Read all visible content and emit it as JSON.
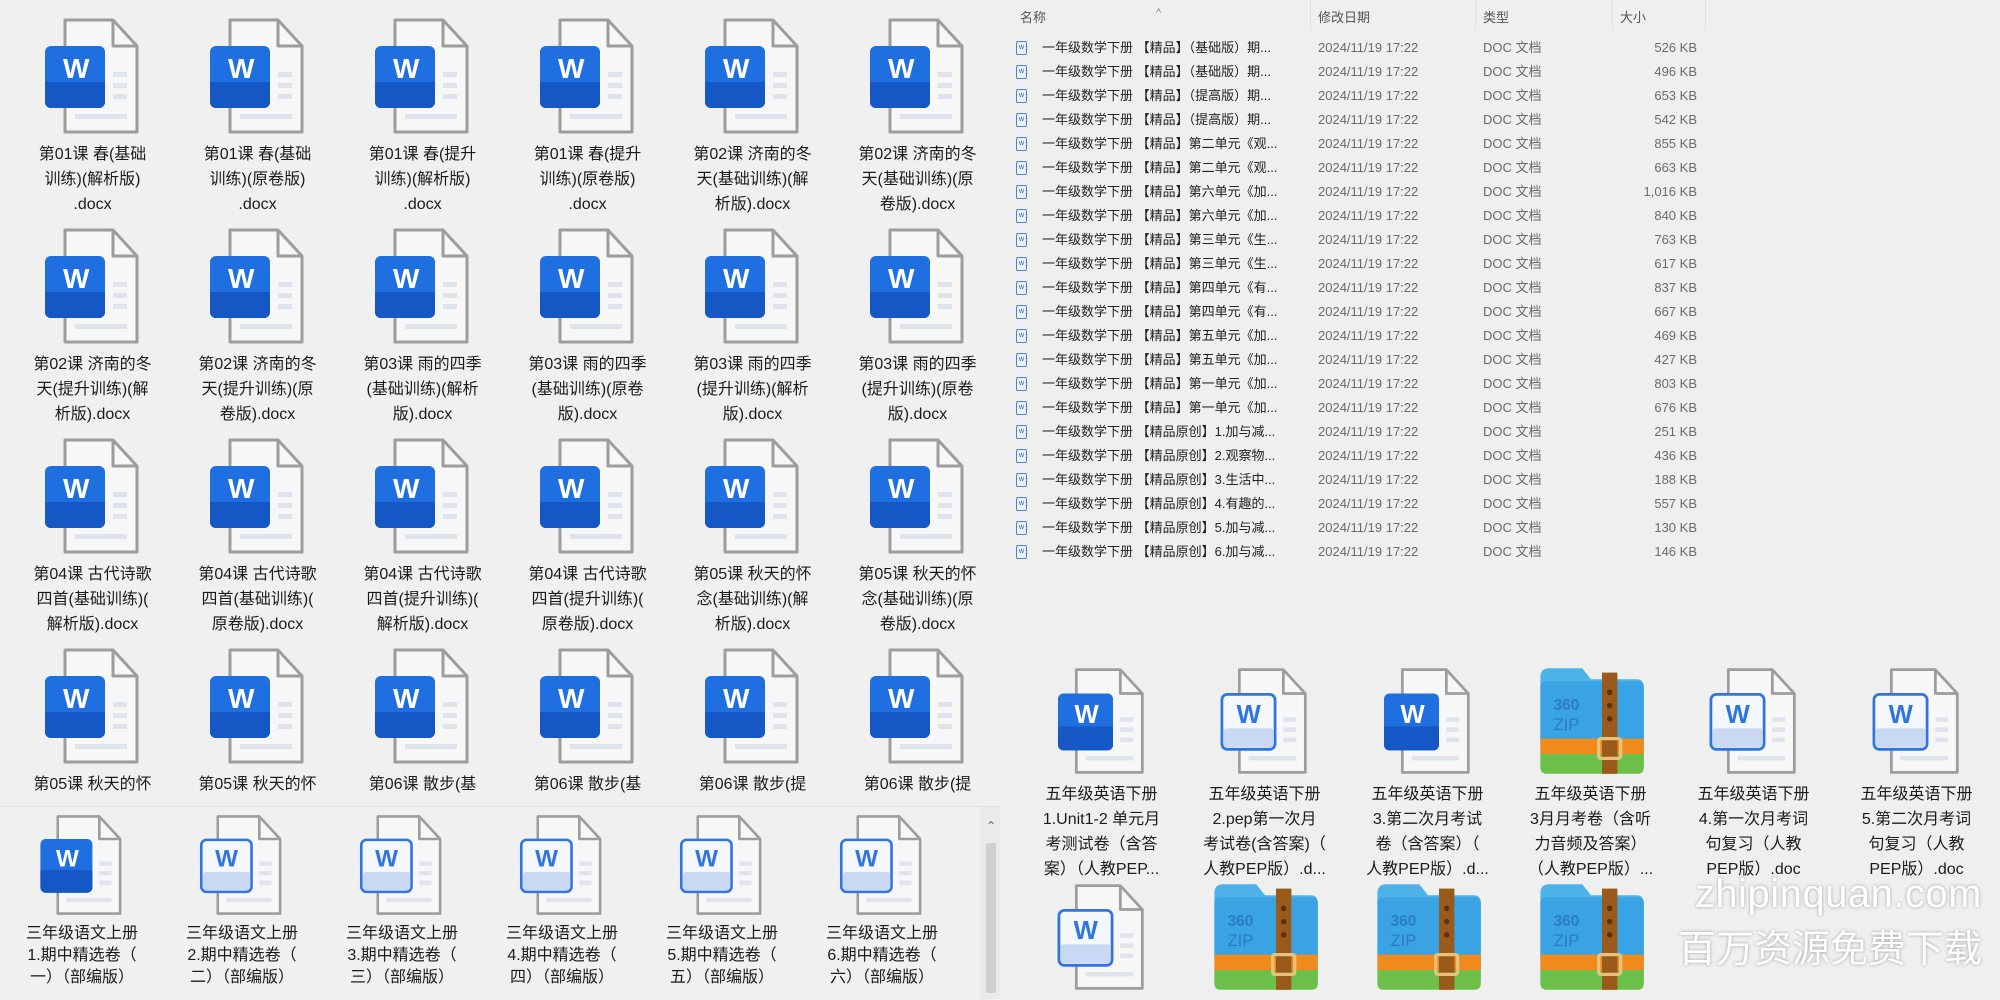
{
  "top_left": {
    "items": [
      {
        "icon": "word-solid",
        "label": "第01课 春(基础\n训练)(解析版)\n.docx"
      },
      {
        "icon": "word-solid",
        "label": "第01课 春(基础\n训练)(原卷版)\n.docx"
      },
      {
        "icon": "word-solid",
        "label": "第01课 春(提升\n训练)(解析版)\n.docx"
      },
      {
        "icon": "word-solid",
        "label": "第01课 春(提升\n训练)(原卷版)\n.docx"
      },
      {
        "icon": "word-solid",
        "label": "第02课 济南的冬\n天(基础训练)(解\n析版).docx"
      },
      {
        "icon": "word-solid",
        "label": "第02课 济南的冬\n天(基础训练)(原\n卷版).docx"
      },
      {
        "icon": "word-solid",
        "label": "第02课 济南的冬\n天(提升训练)(解\n析版).docx"
      },
      {
        "icon": "word-solid",
        "label": "第02课 济南的冬\n天(提升训练)(原\n卷版).docx"
      },
      {
        "icon": "word-solid",
        "label": "第03课 雨的四季\n(基础训练)(解析\n版).docx"
      },
      {
        "icon": "word-solid",
        "label": "第03课 雨的四季\n(基础训练)(原卷\n版).docx"
      },
      {
        "icon": "word-solid",
        "label": "第03课 雨的四季\n(提升训练)(解析\n版).docx"
      },
      {
        "icon": "word-solid",
        "label": "第03课 雨的四季\n(提升训练)(原卷\n版).docx"
      },
      {
        "icon": "word-solid",
        "label": "第04课 古代诗歌\n四首(基础训练)(\n解析版).docx"
      },
      {
        "icon": "word-solid",
        "label": "第04课 古代诗歌\n四首(基础训练)(\n原卷版).docx"
      },
      {
        "icon": "word-solid",
        "label": "第04课 古代诗歌\n四首(提升训练)(\n解析版).docx"
      },
      {
        "icon": "word-solid",
        "label": "第04课 古代诗歌\n四首(提升训练)(\n原卷版).docx"
      },
      {
        "icon": "word-solid",
        "label": "第05课 秋天的怀\n念(基础训练)(解\n析版).docx"
      },
      {
        "icon": "word-solid",
        "label": "第05课 秋天的怀\n念(基础训练)(原\n卷版).docx"
      },
      {
        "icon": "word-solid",
        "label": "第05课 秋天的怀"
      },
      {
        "icon": "word-solid",
        "label": "第05课 秋天的怀"
      },
      {
        "icon": "word-solid",
        "label": "第06课 散步(基"
      },
      {
        "icon": "word-solid",
        "label": "第06课 散步(基"
      },
      {
        "icon": "word-solid",
        "label": "第06课 散步(提"
      },
      {
        "icon": "word-solid",
        "label": "第06课 散步(提"
      }
    ]
  },
  "bottom_left": {
    "items": [
      {
        "icon": "word-solid",
        "label": "三年级语文上册\n1.期中精选卷（\n一）（部编版）"
      },
      {
        "icon": "word-outline",
        "label": "三年级语文上册\n2.期中精选卷（\n二）（部编版）"
      },
      {
        "icon": "word-outline",
        "label": "三年级语文上册\n3.期中精选卷（\n三）（部编版）"
      },
      {
        "icon": "word-outline",
        "label": "三年级语文上册\n4.期中精选卷（\n四）（部编版）"
      },
      {
        "icon": "word-outline",
        "label": "三年级语文上册\n5.期中精选卷（\n五）（部编版）"
      },
      {
        "icon": "word-outline",
        "label": "三年级语文上册\n6.期中精选卷（\n六）（部编版）"
      }
    ]
  },
  "file_list": {
    "columns": {
      "name": "名称",
      "date": "修改日期",
      "type": "类型",
      "size": "大小"
    },
    "sort_indicator": "^",
    "rows": [
      {
        "name": "一年级数学下册 【精品】（基础版）期...",
        "date": "2024/11/19 17:22",
        "type": "DOC 文档",
        "size": "526 KB"
      },
      {
        "name": "一年级数学下册 【精品】（基础版）期...",
        "date": "2024/11/19 17:22",
        "type": "DOC 文档",
        "size": "496 KB"
      },
      {
        "name": "一年级数学下册 【精品】（提高版）期...",
        "date": "2024/11/19 17:22",
        "type": "DOC 文档",
        "size": "653 KB"
      },
      {
        "name": "一年级数学下册 【精品】（提高版）期...",
        "date": "2024/11/19 17:22",
        "type": "DOC 文档",
        "size": "542 KB"
      },
      {
        "name": "一年级数学下册 【精品】第二单元《观...",
        "date": "2024/11/19 17:22",
        "type": "DOC 文档",
        "size": "855 KB"
      },
      {
        "name": "一年级数学下册 【精品】第二单元《观...",
        "date": "2024/11/19 17:22",
        "type": "DOC 文档",
        "size": "663 KB"
      },
      {
        "name": "一年级数学下册 【精品】第六单元《加...",
        "date": "2024/11/19 17:22",
        "type": "DOC 文档",
        "size": "1,016 KB"
      },
      {
        "name": "一年级数学下册 【精品】第六单元《加...",
        "date": "2024/11/19 17:22",
        "type": "DOC 文档",
        "size": "840 KB"
      },
      {
        "name": "一年级数学下册 【精品】第三单元《生...",
        "date": "2024/11/19 17:22",
        "type": "DOC 文档",
        "size": "763 KB"
      },
      {
        "name": "一年级数学下册 【精品】第三单元《生...",
        "date": "2024/11/19 17:22",
        "type": "DOC 文档",
        "size": "617 KB"
      },
      {
        "name": "一年级数学下册 【精品】第四单元《有...",
        "date": "2024/11/19 17:22",
        "type": "DOC 文档",
        "size": "837 KB"
      },
      {
        "name": "一年级数学下册 【精品】第四单元《有...",
        "date": "2024/11/19 17:22",
        "type": "DOC 文档",
        "size": "667 KB"
      },
      {
        "name": "一年级数学下册 【精品】第五单元《加...",
        "date": "2024/11/19 17:22",
        "type": "DOC 文档",
        "size": "469 KB"
      },
      {
        "name": "一年级数学下册 【精品】第五单元《加...",
        "date": "2024/11/19 17:22",
        "type": "DOC 文档",
        "size": "427 KB"
      },
      {
        "name": "一年级数学下册 【精品】第一单元《加...",
        "date": "2024/11/19 17:22",
        "type": "DOC 文档",
        "size": "803 KB"
      },
      {
        "name": "一年级数学下册 【精品】第一单元《加...",
        "date": "2024/11/19 17:22",
        "type": "DOC 文档",
        "size": "676 KB"
      },
      {
        "name": "一年级数学下册 【精品原创】1.加与减...",
        "date": "2024/11/19 17:22",
        "type": "DOC 文档",
        "size": "251 KB"
      },
      {
        "name": "一年级数学下册 【精品原创】2.观察物...",
        "date": "2024/11/19 17:22",
        "type": "DOC 文档",
        "size": "436 KB"
      },
      {
        "name": "一年级数学下册 【精品原创】3.生活中...",
        "date": "2024/11/19 17:22",
        "type": "DOC 文档",
        "size": "188 KB"
      },
      {
        "name": "一年级数学下册 【精品原创】4.有趣的...",
        "date": "2024/11/19 17:22",
        "type": "DOC 文档",
        "size": "557 KB"
      },
      {
        "name": "一年级数学下册 【精品原创】5.加与减...",
        "date": "2024/11/19 17:22",
        "type": "DOC 文档",
        "size": "130 KB"
      },
      {
        "name": "一年级数学下册 【精品原创】6.加与减...",
        "date": "2024/11/19 17:22",
        "type": "DOC 文档",
        "size": "146 KB"
      }
    ]
  },
  "bottom_right": {
    "items": [
      {
        "icon": "word-solid",
        "label": "五年级英语下册\n1.Unit1-2 单元月\n考测试卷（含答\n案）（人教PEP..."
      },
      {
        "icon": "word-outline",
        "label": "五年级英语下册\n2.pep第一次月\n考试卷(含答案)（\n人教PEP版）.d..."
      },
      {
        "icon": "word-solid",
        "label": "五年级英语下册\n3.第二次月考试\n卷（含答案）（\n人教PEP版）.d..."
      },
      {
        "icon": "zip",
        "label": "五年级英语下册\n3月月考卷（含听\n力音频及答案）\n（人教PEP版）..."
      },
      {
        "icon": "word-outline",
        "label": "五年级英语下册\n4.第一次月考词\n句复习（人教\nPEP版）.doc"
      },
      {
        "icon": "word-outline",
        "label": "五年级英语下册\n5.第二次月考词\n句复习（人教\nPEP版）.doc"
      },
      {
        "icon": "word-outline",
        "label": ""
      },
      {
        "icon": "zip",
        "label": ""
      },
      {
        "icon": "zip",
        "label": ""
      },
      {
        "icon": "zip",
        "label": ""
      }
    ]
  },
  "watermark": {
    "domain": "zhipinquan.com",
    "slogan": "百万资源免费下载"
  },
  "zip_icon_text": [
    "360",
    "ZIP"
  ],
  "word_icon_letter": "W",
  "colors": {
    "word_blue": "#1f6fe0",
    "zip_blue": "#3aa3e3",
    "zip_strap": "#9a5a1c",
    "zip_orange": "#f08a1c",
    "zip_green": "#6cc04a"
  }
}
